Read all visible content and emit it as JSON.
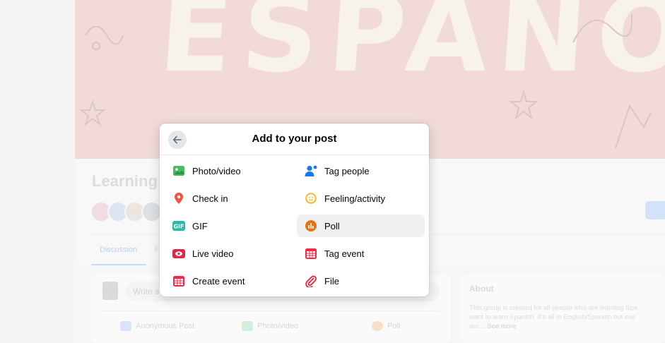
{
  "background": {
    "cover_word": "ESPANOL",
    "group_title": "Learning S",
    "tabs": [
      "Discussion",
      "F"
    ],
    "composer_placeholder": "Write s",
    "composer_actions": [
      "Anonymous Post",
      "Photo/video",
      "Poll"
    ],
    "about": {
      "title": "About",
      "line1": "This group is created for all people who are learning Spa",
      "line2": "want to learn Spanish. It's all in English/Spanish but eve",
      "line3": "acc...",
      "see_more": "See more"
    }
  },
  "modal": {
    "title": "Add to your post",
    "back_icon": "arrow-left-icon",
    "options": [
      {
        "label": "Photo/video",
        "icon": "photo-icon",
        "color": "#45bd62"
      },
      {
        "label": "Tag people",
        "icon": "tag-people-icon",
        "color": "#1877f2"
      },
      {
        "label": "Check in",
        "icon": "location-pin-icon",
        "color": "#f5533d"
      },
      {
        "label": "Feeling/activity",
        "icon": "smiley-icon",
        "color": "#f7b928"
      },
      {
        "label": "GIF",
        "icon": "gif-icon",
        "color": "#2abba7"
      },
      {
        "label": "Poll",
        "icon": "poll-icon",
        "color": "#e9710f"
      },
      {
        "label": "Live video",
        "icon": "live-video-icon",
        "color": "#e42645"
      },
      {
        "label": "Tag event",
        "icon": "calendar-icon",
        "color": "#f02849"
      },
      {
        "label": "Create event",
        "icon": "calendar-icon",
        "color": "#f02849"
      },
      {
        "label": "File",
        "icon": "paperclip-icon",
        "color": "#e42645"
      }
    ]
  }
}
